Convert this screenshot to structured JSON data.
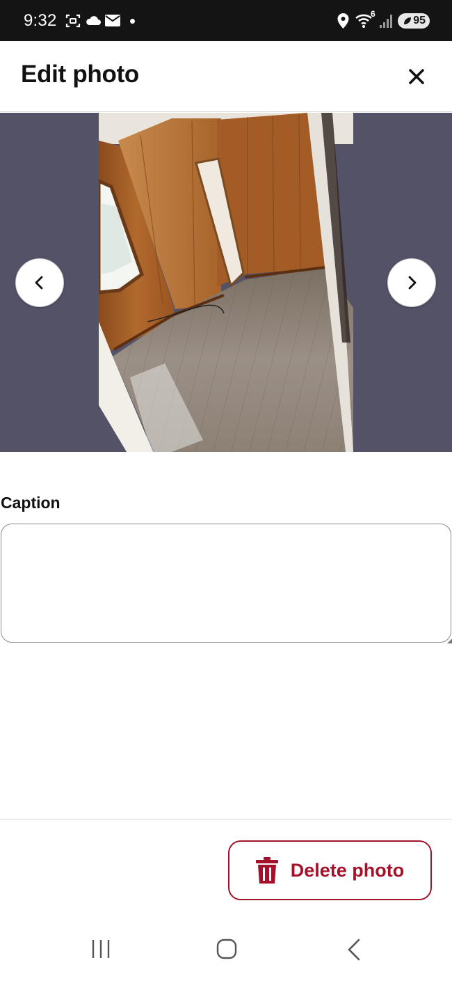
{
  "status_bar": {
    "time": "9:32",
    "battery": "95",
    "network_superscript": "6",
    "icons": [
      "screenshot-icon",
      "cloud-icon",
      "mail-icon",
      "notification-dot",
      "location-icon",
      "wifi-icon",
      "signal-icon",
      "battery-icon"
    ]
  },
  "header": {
    "title": "Edit photo",
    "close_icon": "close-icon"
  },
  "viewer": {
    "prev_icon": "chevron-left-icon",
    "next_icon": "chevron-right-icon",
    "photo_alt": "room-photo"
  },
  "caption": {
    "label": "Caption",
    "value": "",
    "placeholder": ""
  },
  "footer": {
    "delete_label": "Delete photo",
    "delete_icon": "trash-icon"
  },
  "navigation_bar": {
    "icons": [
      "recent-apps-icon",
      "home-icon",
      "back-icon"
    ]
  },
  "colors": {
    "status_bar_bg": "#141414",
    "viewer_bg": "#545267",
    "accent": "#a3122a"
  }
}
